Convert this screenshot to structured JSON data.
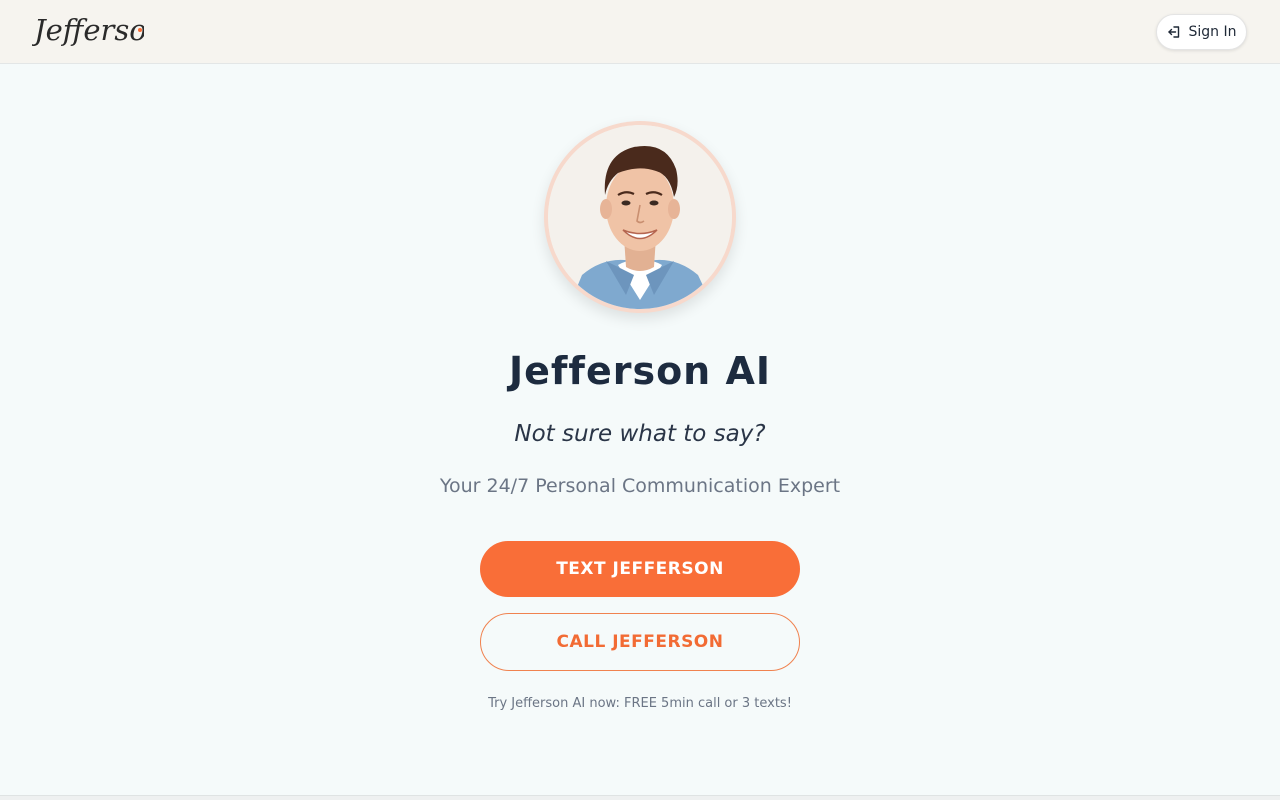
{
  "header": {
    "logo_text": "Jefferson",
    "signin_label": "Sign In",
    "signin_icon": "sign-in-icon"
  },
  "hero": {
    "avatar_alt": "Jefferson",
    "title": "Jefferson AI",
    "tagline": "Not sure what to say?",
    "subtitle": "Your 24/7 Personal Communication Expert"
  },
  "actions": {
    "text_label": "TEXT JEFFERSON",
    "call_label": "CALL JEFFERSON"
  },
  "footer": {
    "trial_text": "Try Jefferson AI now: FREE 5min call or 3 texts!"
  },
  "colors": {
    "accent": "#f96e38",
    "title": "#1d2b3f",
    "muted": "#6b7585",
    "header_bg": "#f6f4ef",
    "page_bg": "#f5fafa"
  }
}
